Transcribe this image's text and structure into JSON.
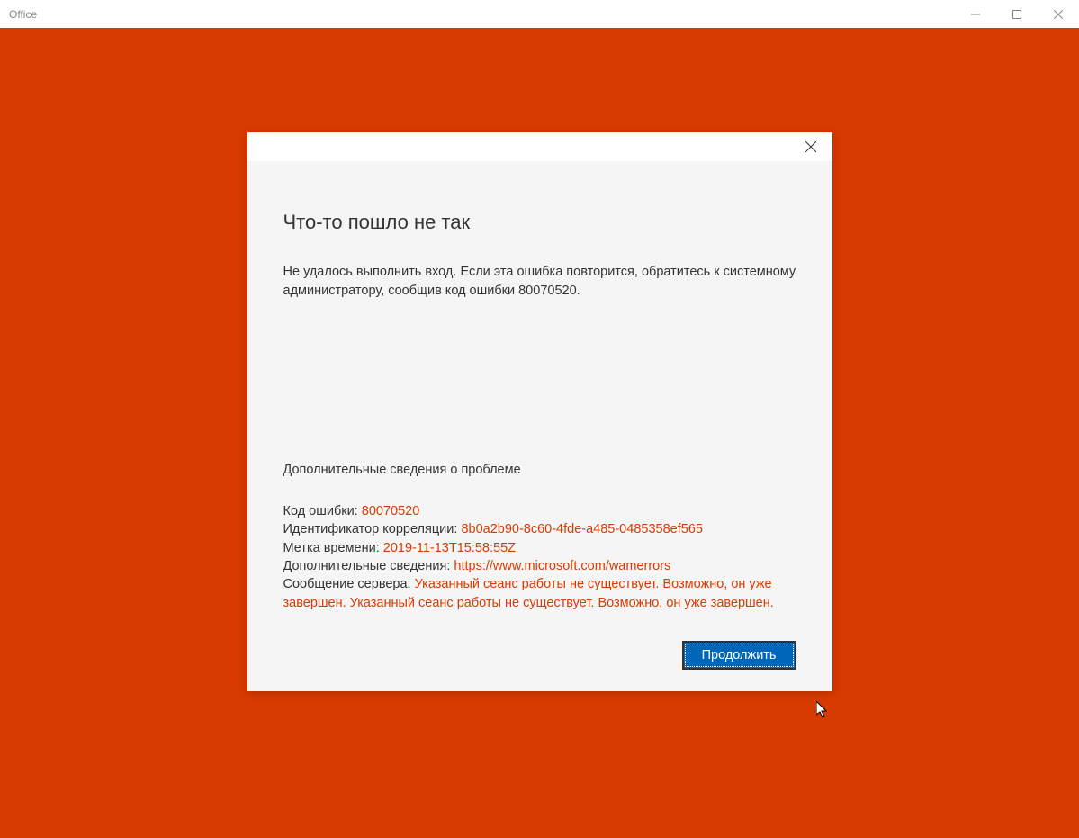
{
  "window": {
    "title": "Office"
  },
  "dialog": {
    "title": "Что-то пошло не так",
    "message": "Не удалось выполнить вход. Если эта ошибка повторится, обратитесь к системному администратору, сообщив код ошибки 80070520.",
    "details_heading": "Дополнительные сведения о проблеме",
    "rows": {
      "error_code": {
        "label": "Код ошибки: ",
        "value": "80070520"
      },
      "correlation_id": {
        "label": "Идентификатор корреляции: ",
        "value": "8b0a2b90-8c60-4fde-a485-0485358ef565"
      },
      "timestamp": {
        "label": "Метка времени: ",
        "value": "2019-11-13T15:58:55Z"
      },
      "more_info": {
        "label": "Дополнительные сведения: ",
        "value": "https://www.microsoft.com/wamerrors"
      },
      "server_msg": {
        "label": "Сообщение сервера: ",
        "value": "Указанный сеанс работы не существует. Возможно, он уже завершен. Указанный сеанс работы не существует. Возможно, он уже завершен."
      }
    },
    "continue_label": "Продолжить"
  }
}
